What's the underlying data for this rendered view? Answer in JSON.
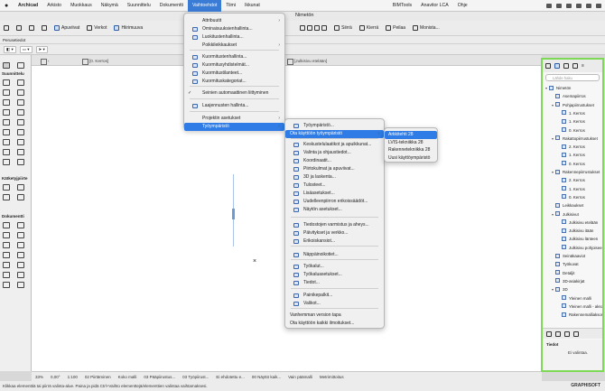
{
  "menubar": {
    "app": "Archicad",
    "items": [
      "Arkisto",
      "Muokkaus",
      "Näkymä",
      "Suunnittelu",
      "Dokumentti",
      "Vaihtoehdot",
      "Tiimi",
      "Ikkunat",
      "BIMTools",
      "Anavitor LCA",
      "Ohje"
    ],
    "active": "Vaihtoehdot"
  },
  "window": {
    "title": "Nimetön"
  },
  "toolbar": {
    "apuviivat": "Apuviivat",
    "verkot": "Verkot",
    "hiiri": "Hiirimuuva",
    "siirra": "Siirrä",
    "kierra": "Kierrä",
    "peilaa": "Peilaa",
    "monista": "Monista..."
  },
  "infobar": {
    "label": "Perusetiedot"
  },
  "tabs": {
    "floor_plan": "[0. Kerros]",
    "elevation": "[Julkisivu etelään]"
  },
  "toolbox": {
    "sections": [
      "Suunnittelu",
      "Kätketyjpiirte",
      "Dokumentti"
    ]
  },
  "vaihtoehdot_menu": {
    "items": [
      {
        "label": "Attribuutit",
        "sub": true
      },
      {
        "label": "Ominaisuuksienhallinta...",
        "icon": true
      },
      {
        "label": "Luokitustenhallinta...",
        "icon": true
      },
      {
        "label": "Poikkileikkaukset",
        "sub": true
      },
      {
        "label": "Kuormitustenhallinta...",
        "icon": true
      },
      {
        "label": "Kuormitusyhdistelmät...",
        "icon": true
      },
      {
        "label": "Kuormitustilanteet...",
        "icon": true
      },
      {
        "label": "Kuormituskategoriat...",
        "icon": true
      },
      {
        "label": "Seinien automaattinen liittyminen",
        "check": true
      },
      {
        "label": "Laajennusten hallinta...",
        "icon": true
      },
      {
        "label": "Projektin asetukset",
        "sub": true
      },
      {
        "label": "Työympäristö",
        "sub": true,
        "selected": true
      }
    ]
  },
  "tyoymparisto_menu": {
    "items": [
      {
        "label": "Työympäristö...",
        "icon": true
      },
      {
        "label": "Ota käyttöön työympäristö",
        "sub": true,
        "selected": true
      },
      {
        "label": "Keskustelulaatikot ja apuikkunat...",
        "icon": true
      },
      {
        "label": "Valinta ja ohjaustiedot...",
        "icon": true
      },
      {
        "label": "Koordinaatit...",
        "icon": true
      },
      {
        "label": "Piirtokulmat ja apuviivat...",
        "icon": true
      },
      {
        "label": "3D ja laskenta...",
        "icon": true
      },
      {
        "label": "Tulosteet...",
        "icon": true
      },
      {
        "label": "Tulosteet...",
        "icon": true
      },
      {
        "label": "Lisäasetukset...",
        "icon": true
      },
      {
        "label": "Uudelleenpiirron erikoissäädöt...",
        "icon": true
      },
      {
        "label": "Näytön asetukset...",
        "icon": true
      },
      {
        "label": "Tiedostojen varmistus ja aheys...",
        "icon": true
      },
      {
        "label": "Päivitykset ja verkko...",
        "icon": true
      },
      {
        "label": "Erikoiskansiot...",
        "icon": true
      },
      {
        "label": "Näppäinoikotiet...",
        "icon": true
      },
      {
        "label": "Työkalut...",
        "icon": true
      },
      {
        "label": "Työkaluasetukset...",
        "icon": true
      },
      {
        "label": "Tiedot...",
        "icon": true
      },
      {
        "label": "Painikepalkit...",
        "icon": true
      },
      {
        "label": "Valikot...",
        "icon": true
      },
      {
        "label": "Vanhemman version tapa",
        "icon": false
      },
      {
        "label": "Ota käyttöön kaikki ilmoitukset...",
        "icon": false
      }
    ]
  },
  "profile_menu": {
    "items": [
      {
        "label": "Arkkitehti 28",
        "selected": true
      },
      {
        "label": "LVIS-tekniikka 28"
      },
      {
        "label": "Rakennetekniikka 28"
      },
      {
        "label": "Uusi käyttöympäristö"
      }
    ]
  },
  "navigator": {
    "search_placeholder": "Lähde haku",
    "tree": [
      {
        "label": "Nimetön",
        "level": 0,
        "arrow": "▾"
      },
      {
        "label": "Asemapiirros",
        "level": 1
      },
      {
        "label": "Pohjapiirrustukset",
        "level": 1,
        "arrow": "▾"
      },
      {
        "label": "1. Kerros",
        "level": 2
      },
      {
        "label": "1. Kerros",
        "level": 2
      },
      {
        "label": "0. Kerros",
        "level": 2
      },
      {
        "label": "Rakattopiirrustukset",
        "level": 1,
        "arrow": "▾"
      },
      {
        "label": "2. Kerros",
        "level": 2
      },
      {
        "label": "1. Kerros",
        "level": 2
      },
      {
        "label": "0. Kerros",
        "level": 2
      },
      {
        "label": "Rakennepiirrustukset",
        "level": 1,
        "arrow": "▾"
      },
      {
        "label": "2. Kerros",
        "level": 2
      },
      {
        "label": "1. Kerros",
        "level": 2
      },
      {
        "label": "0. Kerros",
        "level": 2
      },
      {
        "label": "Leikkaukset",
        "level": 1
      },
      {
        "label": "Julkisivut",
        "level": 1,
        "arrow": "▾"
      },
      {
        "label": "Julkisivu etelään",
        "level": 2
      },
      {
        "label": "Julkisivu itään",
        "level": 2
      },
      {
        "label": "Julkisivu länteen",
        "level": 2
      },
      {
        "label": "Julkisivu pohjoiseen",
        "level": 2
      },
      {
        "label": "Seinäkaaviot",
        "level": 1
      },
      {
        "label": "Työkuvat",
        "level": 1
      },
      {
        "label": "Detaljit",
        "level": 1
      },
      {
        "label": "3D-asiakirjat",
        "level": 1
      },
      {
        "label": "3D",
        "level": 1,
        "arrow": "▾"
      },
      {
        "label": "Yleinen malli",
        "level": 2
      },
      {
        "label": "Yleinen malli - aksonometria",
        "level": 2
      },
      {
        "label": "Rakennemalliaksonometria",
        "level": 2
      }
    ],
    "props_title": "Tiedot",
    "props_value": "Ei valintaa."
  },
  "status": {
    "zoom": "33%",
    "angle": "0,00°",
    "scale": "1:100",
    "layer": "02 Piirtäminen",
    "model": "Koko malli",
    "pen": "03 Pääpiirustus...",
    "type": "03 Työpiirust...",
    "renov": "Ei ehdotettu e...",
    "view": "00 Näyttö kaik...",
    "only": "Vain päämalli",
    "unit": "Metrimittoitus"
  },
  "hint": "Klikkaa elementtiä tai piirrä valinta-alue. Paina ja pidä Ctrl+Vaihto elementtejä/elementtien valintaa vaihtamaksesi.",
  "brand": "GRAPHISOFT"
}
